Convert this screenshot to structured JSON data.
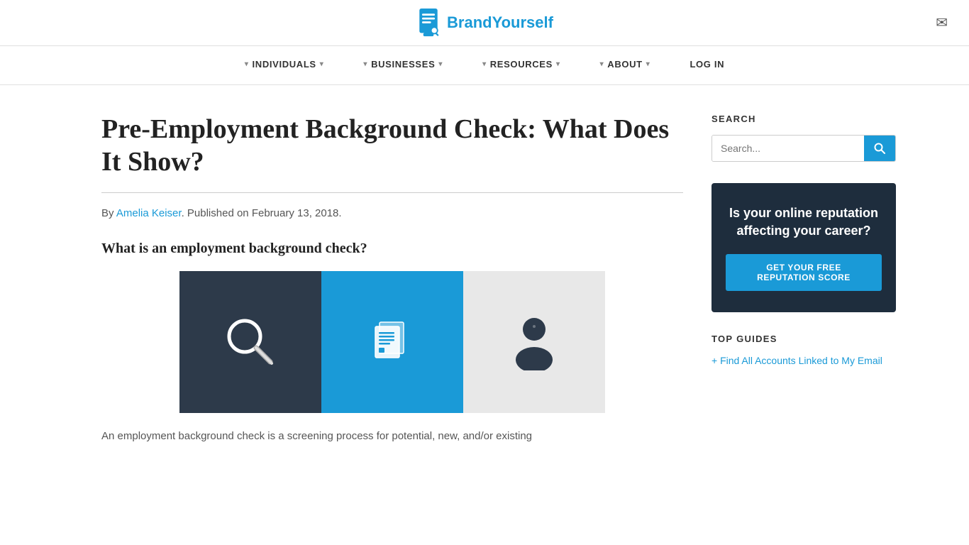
{
  "header": {
    "logo_text": "BrandYourself",
    "email_icon": "✉"
  },
  "nav": {
    "items": [
      {
        "label": "INDIVIDUALS",
        "arrow": "▼",
        "has_dropdown": true
      },
      {
        "label": "BUSINESSES",
        "arrow": "▼",
        "has_dropdown": true
      },
      {
        "label": "RESOURCES",
        "arrow": "▼",
        "has_dropdown": true
      },
      {
        "label": "ABOUT",
        "arrow": "▼",
        "has_dropdown": true
      },
      {
        "label": "LOG IN",
        "has_dropdown": false
      }
    ]
  },
  "article": {
    "title": "Pre-Employment Background Check: What Does It Show?",
    "byline_prefix": "By ",
    "author_name": "Amelia Keiser",
    "byline_suffix": ". Published on February 13, 2018.",
    "section_heading": "What is an employment background check?",
    "body_text": "An employment background check is a screening process for potential, new, and/or existing"
  },
  "sidebar": {
    "search_section": {
      "heading": "SEARCH",
      "search_placeholder": "Search...",
      "search_button_icon": "🔍"
    },
    "ad_banner": {
      "text": "Is your online reputation affecting your career?",
      "button_label": "GET YOUR FREE REPUTATION SCORE"
    },
    "top_guides": {
      "heading": "TOP GUIDES",
      "links": [
        {
          "label": "+ Find All Accounts Linked to My Email"
        }
      ]
    }
  }
}
